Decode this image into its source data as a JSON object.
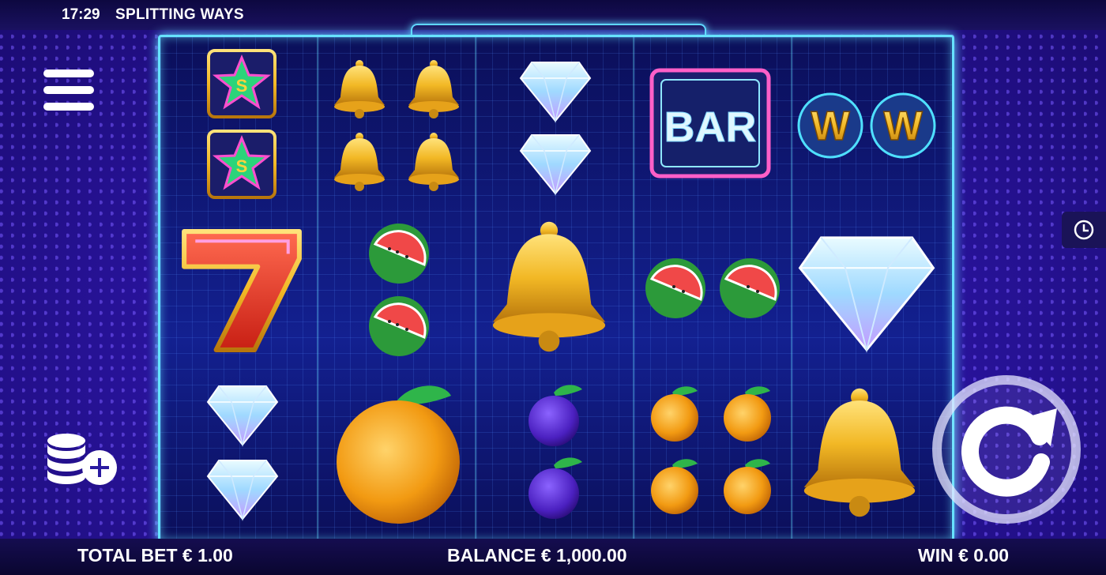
{
  "status": {
    "clock": "17:29",
    "game_title": "SPLITTING WAYS"
  },
  "colors": {
    "frame_glow": "#67e2ff",
    "bg": "#2f1aa8",
    "text": "#ffffff"
  },
  "controls": {
    "menu_icon": "hamburger-menu-icon",
    "history_icon": "clock-history-icon",
    "bet_icon": "coin-stack-plus-icon",
    "spin_icon": "spin-arrow-icon"
  },
  "reels": [
    {
      "symbols": [
        "star-s-scatter",
        "star-s-scatter",
        "seven",
        "diamond",
        "diamond"
      ]
    },
    {
      "symbols": [
        "bell",
        "bell",
        "bell",
        "bell",
        "watermelon",
        "watermelon",
        "orange"
      ]
    },
    {
      "symbols": [
        "diamond",
        "diamond",
        "bell",
        "plum",
        "plum"
      ]
    },
    {
      "symbols": [
        "bar",
        "watermelon",
        "watermelon",
        "orange",
        "orange",
        "orange",
        "orange"
      ]
    },
    {
      "symbols": [
        "wild",
        "wild",
        "diamond",
        "bell"
      ]
    }
  ],
  "symbol_text": {
    "bar": "BAR",
    "wild": "W",
    "scatter": "S",
    "seven": "7"
  },
  "footer": {
    "total_bet": "TOTAL BET € 1.00",
    "balance": "BALANCE € 1,000.00",
    "win": "WIN € 0.00"
  }
}
